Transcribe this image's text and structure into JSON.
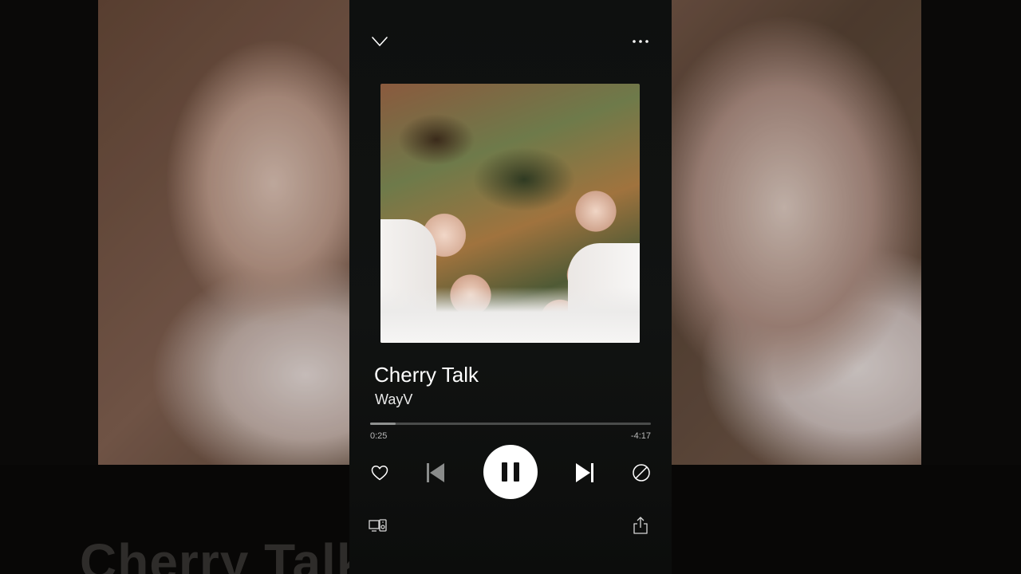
{
  "background": {
    "title_text": "Cherry Talk"
  },
  "player": {
    "collapse_icon": "chevron-down-icon",
    "more_icon": "more-options-icon",
    "album_art_alt": "Cherry Talk album artwork",
    "song_title": "Cherry Talk",
    "artist": "WayV",
    "progress_fraction": 0.09,
    "elapsed": "0:25",
    "remaining": "-4:17",
    "controls": {
      "like_icon": "heart-icon",
      "previous_icon": "skip-previous-icon",
      "play_pause_icon": "pause-icon",
      "next_icon": "skip-next-icon",
      "hide_icon": "block-icon"
    },
    "bottom": {
      "devices_icon": "connect-devices-icon",
      "share_icon": "share-icon"
    },
    "colors": {
      "panel": "#101211",
      "accent": "#ffffff",
      "progress_track": "#4a4c4b",
      "progress_fill": "#8f9190"
    }
  }
}
